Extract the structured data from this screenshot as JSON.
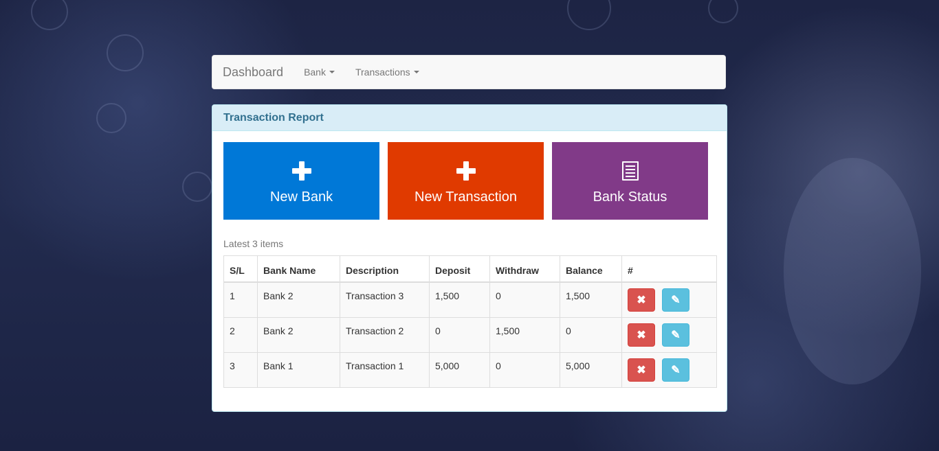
{
  "navbar": {
    "brand": "Dashboard",
    "menus": [
      {
        "label": "Bank"
      },
      {
        "label": "Transactions"
      }
    ]
  },
  "panel": {
    "title": "Transaction Report"
  },
  "tiles": [
    {
      "label": "New Bank",
      "color": "#0078d7",
      "icon": "plus-icon"
    },
    {
      "label": "New Transaction",
      "color": "#e03a00",
      "icon": "plus-icon"
    },
    {
      "label": "Bank Status",
      "color": "#813a88",
      "icon": "list-icon"
    }
  ],
  "latest_caption": "Latest 3 items",
  "table": {
    "headers": [
      "S/L",
      "Bank Name",
      "Description",
      "Deposit",
      "Withdraw",
      "Balance",
      "#"
    ],
    "rows": [
      [
        "1",
        "Bank 2",
        "Transaction 3",
        "1,500",
        "0",
        "1,500"
      ],
      [
        "2",
        "Bank 2",
        "Transaction 2",
        "0",
        "1,500",
        "0"
      ],
      [
        "3",
        "Bank 1",
        "Transaction 1",
        "5,000",
        "0",
        "5,000"
      ]
    ],
    "delete_symbol": "✖",
    "edit_symbol": "✎"
  }
}
